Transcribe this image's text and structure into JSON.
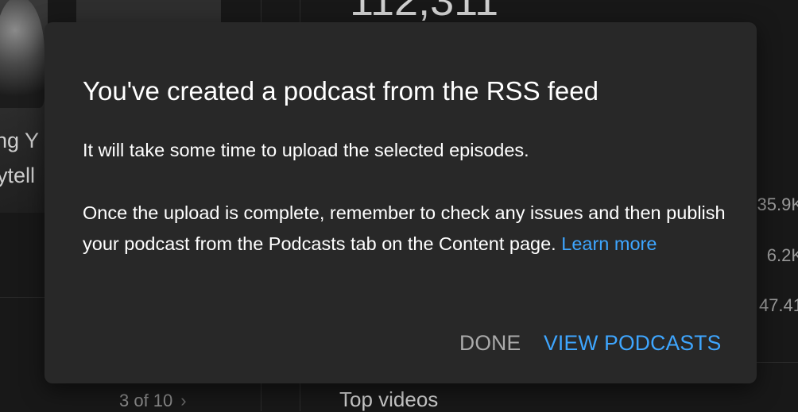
{
  "background": {
    "thumbnail_text_line1": "ng Y",
    "thumbnail_text_line2": "ytell",
    "big_number": "112,311",
    "stats": [
      "35.9K",
      "6.2K",
      "47.41"
    ],
    "pager": "3 of 10",
    "pager_next_icon": "chevron-right-icon",
    "top_videos_heading": "Top videos"
  },
  "dialog": {
    "title": "You've created a podcast from the RSS feed",
    "paragraph1": "It will take some time to upload the selected episodes.",
    "paragraph2": "Once the upload is complete, remember to check any issues and then publish your podcast from the Podcasts tab on the Content page.",
    "learn_more": "Learn more",
    "done_button": "DONE",
    "view_podcasts_button": "VIEW PODCASTS"
  },
  "colors": {
    "dialog_background": "#282828",
    "page_background": "#181818",
    "accent_blue": "#3ea6ff",
    "secondary_button": "#aaaaaa"
  }
}
